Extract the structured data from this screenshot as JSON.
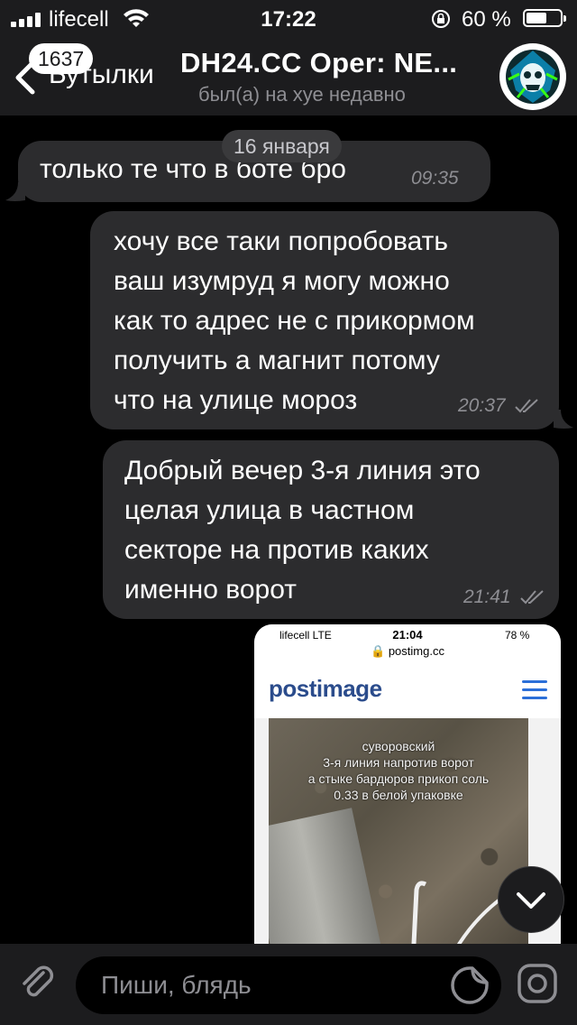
{
  "status_bar": {
    "carrier": "lifecell",
    "time": "17:22",
    "battery": "60 %",
    "battery_level": 0.6
  },
  "nav": {
    "unread_count": "1637",
    "back_label": "Бутылки",
    "title": "DH24.CC Oper: NE...",
    "subtitle": "был(а) на хуе недавно",
    "avatar_icon": "group-avatar-icon"
  },
  "chat": {
    "date_label": "16 января",
    "messages": [
      {
        "direction": "in",
        "text": "только те что в боте бро",
        "time": "09:35"
      },
      {
        "direction": "out",
        "text": "хочу все таки попробовать\nваш изумруд я могу можно\nкак то адрес не с прикормом\nполучить а магнит  потому\nчто на улице мороз",
        "time": "20:37",
        "status": "read"
      },
      {
        "direction": "out",
        "text": "Добрый вечер 3-я линия это\nцелая улица в частном\nсекторе на против каких\nименно ворот",
        "time": "21:41",
        "status": "read"
      }
    ],
    "image_message": {
      "carrier": "lifecell  LTE",
      "time": "21:04",
      "battery": "78 %",
      "url": "postimg.cc",
      "logo": "postimage",
      "caption": "суворовский\n3-я линия напротив ворот\nа стыке бардюров прикоп соль\n0.33 в белой упаковке"
    }
  },
  "input_bar": {
    "placeholder": "Пиши, блядь"
  },
  "colors": {
    "bar_bg": "#1c1c1e",
    "bubble_bg": "#2c2c2e",
    "secondary_text": "#8e8e93",
    "postimage_blue": "#2b4c8c"
  }
}
